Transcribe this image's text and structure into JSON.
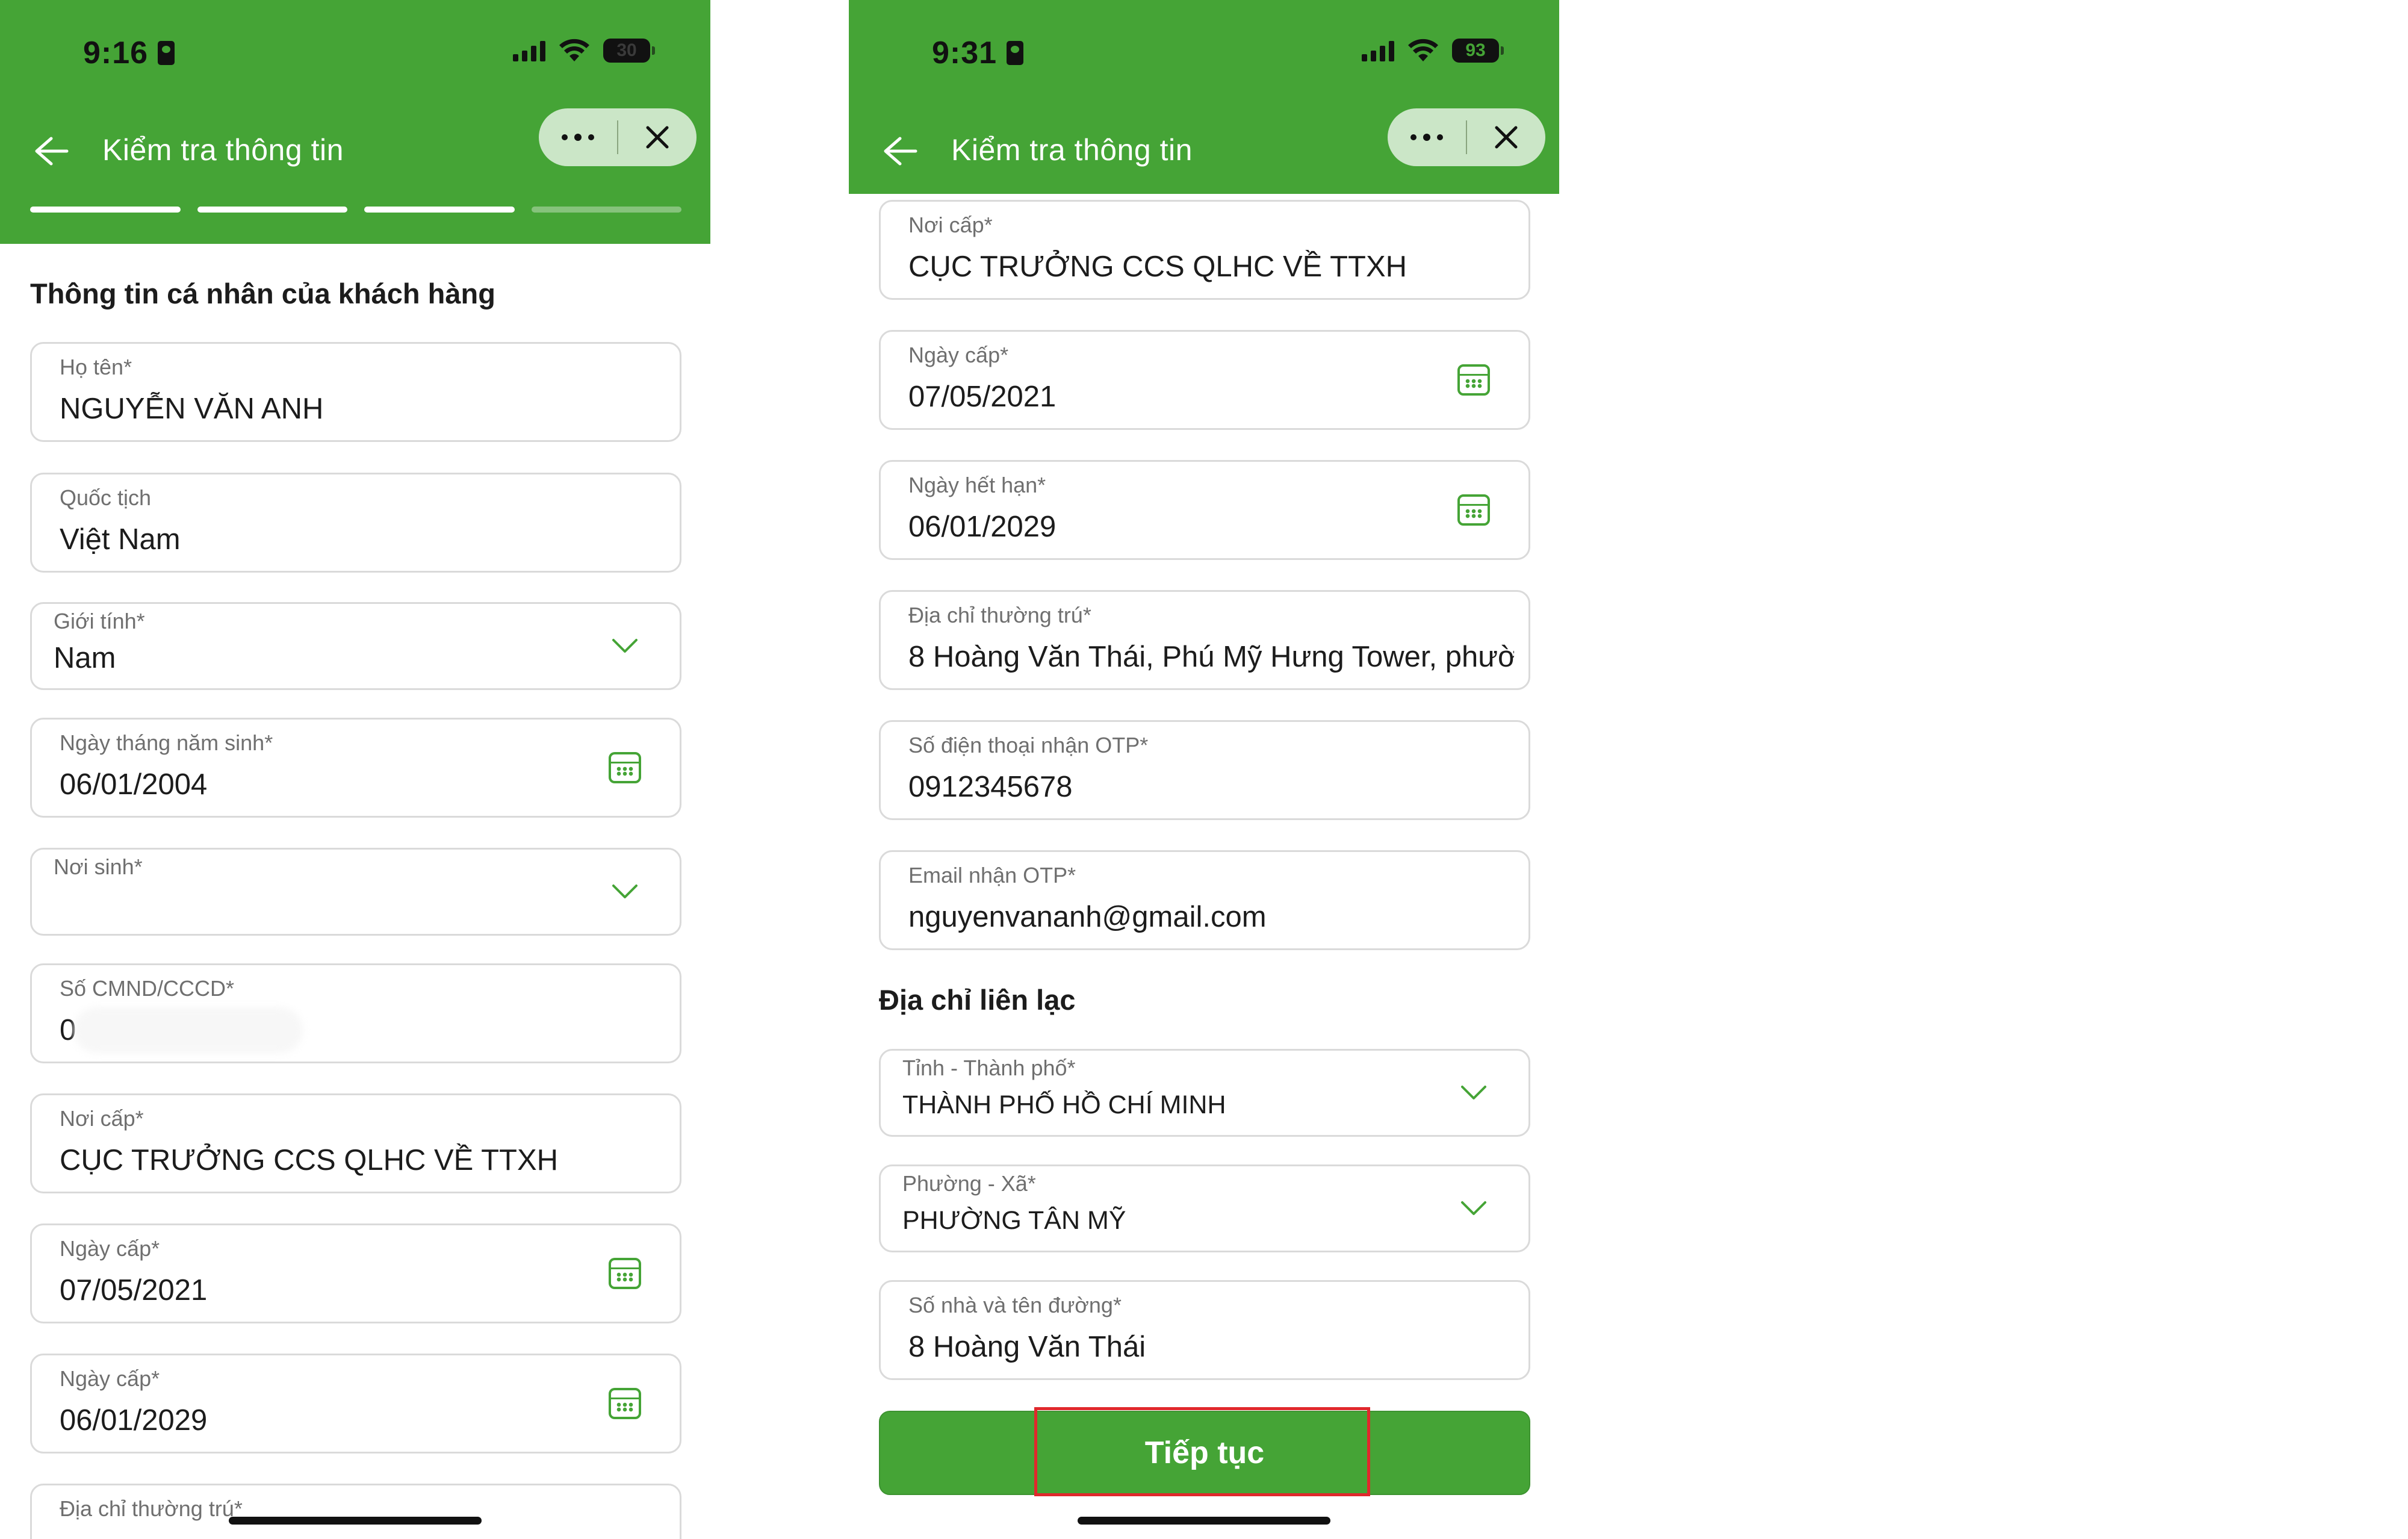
{
  "colors": {
    "brand_green": "#45a436",
    "highlight_red": "#e0282c",
    "field_border": "#dadada"
  },
  "left_screen": {
    "status": {
      "time": "9:16",
      "battery": "30",
      "battery_icon": "battery-low-icon"
    },
    "nav": {
      "title": "Kiểm tra thông tin",
      "back_icon": "arrow-left-icon",
      "more_icon": "more-dots-icon",
      "close_icon": "close-icon"
    },
    "progress": {
      "steps_total": 4,
      "steps_completed": 3
    },
    "section_title": "Thông tin cá nhân của khách hàng",
    "fields": [
      {
        "label": "Họ tên*",
        "value": "NGUYỄN VĂN ANH",
        "type": "text"
      },
      {
        "label": "Quốc tịch",
        "value": "Việt Nam",
        "type": "text"
      },
      {
        "label": "Giới tính*",
        "value": "Nam",
        "type": "select"
      },
      {
        "label": "Ngày tháng năm sinh*",
        "value": "06/01/2004",
        "type": "date"
      },
      {
        "label": "Nơi sinh*",
        "value": "",
        "type": "select"
      },
      {
        "label": "Số CMND/CCCD*",
        "value": "0",
        "type": "masked"
      },
      {
        "label": "Nơi cấp*",
        "value": "CỤC TRƯỞNG CCS QLHC VỀ TTXH",
        "type": "text"
      },
      {
        "label": "Ngày cấp*",
        "value": "07/05/2021",
        "type": "date"
      },
      {
        "label": "Ngày cấp*",
        "value": "06/01/2029",
        "type": "date"
      },
      {
        "label": "Địa chỉ thường trú*",
        "value": "",
        "type": "text"
      }
    ]
  },
  "right_screen": {
    "status": {
      "time": "9:31",
      "battery": "93"
    },
    "nav": {
      "title": "Kiểm tra thông tin"
    },
    "fields": [
      {
        "label": "Nơi cấp*",
        "value": "CỤC TRƯỞNG CCS QLHC VỀ TTXH",
        "type": "text"
      },
      {
        "label": "Ngày cấp*",
        "value": "07/05/2021",
        "type": "date"
      },
      {
        "label": "Ngày hết hạn*",
        "value": "06/01/2029",
        "type": "date"
      },
      {
        "label": "Địa chỉ thường trú*",
        "value": "8 Hoàng Văn Thái, Phú Mỹ Hưng Tower, phườ",
        "type": "text"
      },
      {
        "label": "Số điện thoại nhận OTP*",
        "value": "0912345678",
        "type": "text"
      },
      {
        "label": "Email nhận OTP*",
        "value": "nguyenvananh@gmail.com",
        "type": "text"
      }
    ],
    "contact_section_title": "Địa chỉ liên lạc",
    "contact_fields": [
      {
        "label": "Tỉnh - Thành phố*",
        "value": "THÀNH PHỐ HỒ CHÍ MINH",
        "type": "select"
      },
      {
        "label": "Phường - Xã*",
        "value": "PHƯỜNG TÂN MỸ",
        "type": "select"
      },
      {
        "label": "Số nhà và tên đường*",
        "value": "8 Hoàng Văn Thái",
        "type": "text"
      }
    ],
    "continue_label": "Tiếp tục"
  }
}
